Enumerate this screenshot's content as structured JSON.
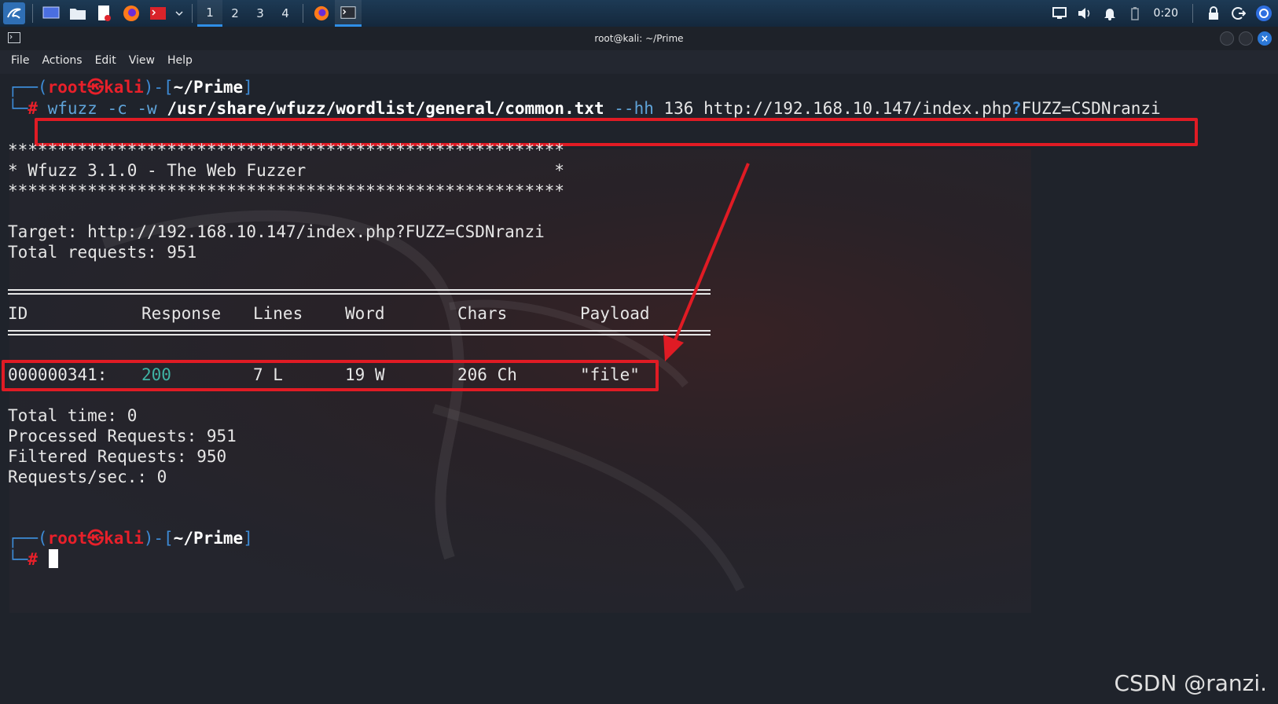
{
  "taskbar": {
    "workspaces": [
      "1",
      "2",
      "3",
      "4"
    ],
    "active_workspace": "1",
    "clock": "0:20"
  },
  "window": {
    "title": "root@kali: ~/Prime",
    "menu": [
      "File",
      "Actions",
      "Edit",
      "View",
      "Help"
    ]
  },
  "terminal": {
    "prompt": {
      "open": "┌──(",
      "user": "root",
      "skull": "㉿",
      "host": "kali",
      "mid": ")-[",
      "path": "~/Prime",
      "close": "]",
      "corner": "└─",
      "hash": "#"
    },
    "command": {
      "program": "wfuzz",
      "flags": " -c -w ",
      "wordlist": "/usr/share/wfuzz/wordlist/general/common.txt",
      "hh_flag": " --hh",
      "hh_value": " 136 http://192.168.10.147/index.php",
      "qmark": "?",
      "query": "FUZZ=CSDNranzi"
    },
    "banner_stars": "********************************************************",
    "banner_title": "* Wfuzz 3.1.0 - The Web Fuzzer                         *",
    "target": "Target: http://192.168.10.147/index.php?FUZZ=CSDNranzi",
    "total_requests": "Total requests: 951",
    "columns": {
      "id": "ID",
      "response": "Response",
      "lines": "Lines",
      "word": "Word",
      "chars": "Chars",
      "payload": "Payload"
    },
    "result": {
      "id": "000000341:",
      "response": "200",
      "lines": "7 L",
      "word": "19 W",
      "chars": "206 Ch",
      "payload": "\"file\""
    },
    "summary": [
      "Total time: 0",
      "Processed Requests: 951",
      "Filtered Requests: 950",
      "Requests/sec.: 0"
    ]
  },
  "watermark": "CSDN @ranzi.",
  "colors": {
    "highlight": "#e01b24",
    "prompt_blue": "#3d8bd6",
    "prompt_red": "#e8202a",
    "status_ok": "#3fb3a4"
  }
}
